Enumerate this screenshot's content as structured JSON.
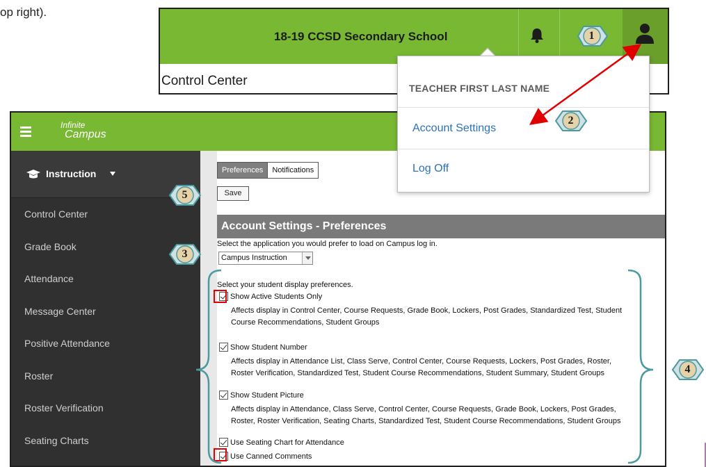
{
  "document": {
    "fragment_text": "op right)."
  },
  "header": {
    "school_name": "18-19 CCSD Secondary School",
    "page_title": "Control Center"
  },
  "user_menu": {
    "user_name": "TEACHER FIRST LAST NAME",
    "account_settings_label": "Account Settings",
    "log_off_label": "Log Off"
  },
  "app": {
    "logo_line1": "Infinite",
    "logo_line2": "Campus",
    "brand_color": "#79b833",
    "sidebar": {
      "module_label": "Instruction",
      "items": [
        {
          "label": "Control Center"
        },
        {
          "label": "Grade Book"
        },
        {
          "label": "Attendance"
        },
        {
          "label": "Message Center"
        },
        {
          "label": "Positive Attendance"
        },
        {
          "label": "Roster"
        },
        {
          "label": "Roster Verification"
        },
        {
          "label": "Seating Charts"
        }
      ]
    },
    "tabs": [
      {
        "label": "Preferences",
        "active": true
      },
      {
        "label": "Notifications",
        "active": false
      }
    ],
    "save_label": "Save",
    "section_title": "Account Settings - Preferences",
    "app_prompt": "Select the application you would prefer to load on Campus log in.",
    "app_select_value": "Campus Instruction",
    "display_prompt": "Select your student display preferences.",
    "options": [
      {
        "label": "Show Active Students Only",
        "checked": true,
        "description": "Affects display in Control Center, Course Requests, Grade Book, Lockers, Post Grades, Standardized Test, Student Course Recommendations, Student Groups"
      },
      {
        "label": "Show Student Number",
        "checked": true,
        "description": "Affects display in Attendance List, Class Serve, Control Center, Course Requests, Lockers, Post Grades, Roster, Roster Verification, Standardized Test, Student Course Recommendations, Student Summary, Student Groups"
      },
      {
        "label": "Show Student Picture",
        "checked": true,
        "description": "Affects display in Attendance, Class Serve, Control Center, Course Requests, Grade Book, Lockers, Post Grades, Roster, Roster Verification, Seating Charts, Standardized Test, Student Course Recommendations, Student Groups"
      },
      {
        "label": "Use Seating Chart for Attendance",
        "checked": true
      },
      {
        "label": "Use Canned Comments",
        "checked": true
      }
    ]
  },
  "annotations": {
    "badges": [
      "1",
      "2",
      "3",
      "4",
      "5"
    ],
    "badge_fill": "#cfe1e3",
    "badge_stroke": "#4a9aa0",
    "arrow_color": "#e00000"
  }
}
